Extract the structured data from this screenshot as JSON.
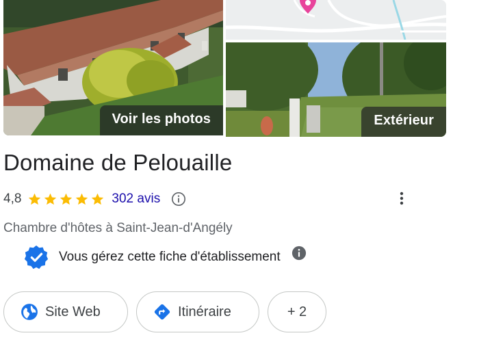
{
  "photos": {
    "main_label": "Voir les photos",
    "exterior_label": "Extérieur"
  },
  "place": {
    "title": "Domaine de Pelouaille",
    "rating": "4,8",
    "stars_filled": 5,
    "reviews": "302 avis",
    "category": "Chambre d'hôtes à Saint-Jean-d'Angély",
    "verified_text": "Vous gérez cette fiche d'établissement"
  },
  "actions": {
    "website_label": "Site Web",
    "directions_label": "Itinéraire",
    "more_label": "+ 2"
  },
  "colors": {
    "star": "#fbbc04",
    "link": "#1a0dab",
    "verified": "#1a73e8",
    "chip_icon": "#1a73e8",
    "map_pin": "#e8439b"
  },
  "icons": {
    "star": "star-icon",
    "info_outline": "info-outline-icon",
    "more": "more-vert-icon",
    "verified": "verified-badge-icon",
    "info_filled": "info-filled-icon",
    "website": "globe-icon",
    "directions": "directions-icon",
    "map_pin": "map-pin-icon"
  }
}
